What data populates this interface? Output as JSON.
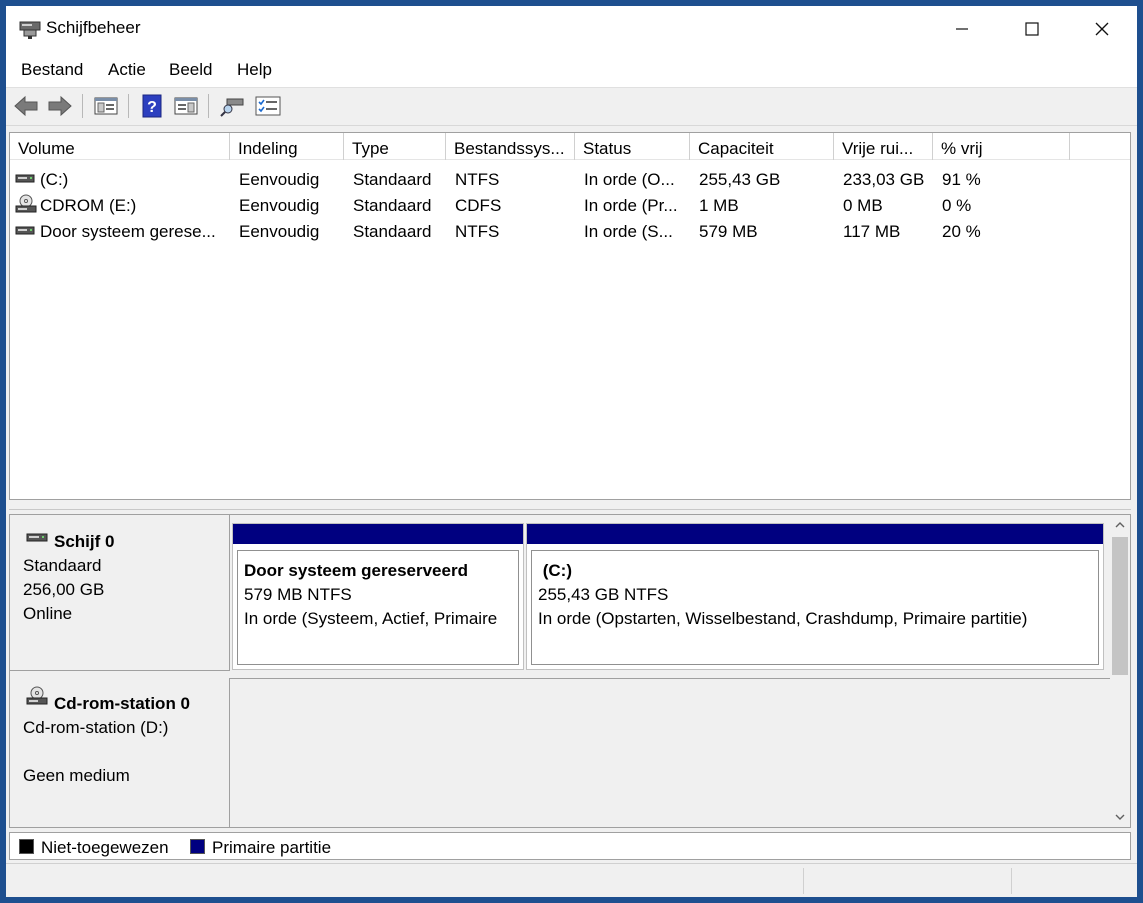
{
  "window": {
    "title": "Schijfbeheer"
  },
  "menu": {
    "items": [
      "Bestand",
      "Actie",
      "Beeld",
      "Help"
    ]
  },
  "toolbar": {
    "icons": [
      "back-arrow-icon",
      "forward-arrow-icon",
      "console-tree-icon",
      "help-icon",
      "action-pane-icon",
      "rescan-disks-icon",
      "properties-checklist-icon"
    ]
  },
  "list": {
    "columns": [
      "Volume",
      "Indeling",
      "Type",
      "Bestandssys...",
      "Status",
      "Capaciteit",
      "Vrije rui...",
      "% vrij"
    ],
    "rows": [
      {
        "icon": "drive-icon",
        "cells": [
          " (C:)",
          "Eenvoudig",
          "Standaard",
          "NTFS",
          "In orde (O...",
          "255,43 GB",
          "233,03 GB",
          "91 %"
        ]
      },
      {
        "icon": "cdrom-icon",
        "cells": [
          "CDROM (E:)",
          "Eenvoudig",
          "Standaard",
          "CDFS",
          "In orde (Pr...",
          "1 MB",
          "0 MB",
          "0 %"
        ]
      },
      {
        "icon": "drive-icon",
        "cells": [
          "Door systeem gerese...",
          "Eenvoudig",
          "Standaard",
          "NTFS",
          "In orde (S...",
          "579 MB",
          "117 MB",
          "20 %"
        ]
      }
    ]
  },
  "disks": [
    {
      "name": "Schijf 0",
      "lines": [
        "Standaard",
        "256,00 GB",
        "Online"
      ],
      "partitions": [
        {
          "title": "Door systeem gereserveerd",
          "size": "579 MB NTFS",
          "status": "In orde (Systeem, Actief, Primaire"
        },
        {
          "title": " (C:)",
          "size": "255,43 GB NTFS",
          "status": "In orde (Opstarten, Wisselbestand, Crashdump, Primaire partitie)"
        }
      ]
    },
    {
      "name": "Cd-rom-station 0",
      "lines": [
        "Cd-rom-station (D:)",
        "",
        "Geen medium"
      ]
    }
  ],
  "legend": [
    {
      "label": "Niet-toegewezen",
      "color": "#000000"
    },
    {
      "label": "Primaire partitie",
      "color": "#000080"
    }
  ],
  "colors": {
    "primary_partition": "#000080",
    "unallocated": "#000000"
  }
}
